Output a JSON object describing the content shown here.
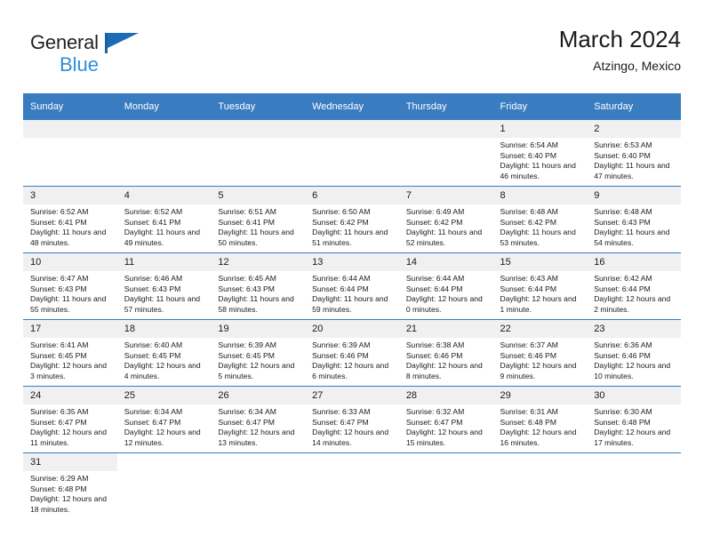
{
  "brand": {
    "name_part1": "General",
    "name_part2": "Blue",
    "flag_icon": "blue-flag-icon",
    "color_dark": "#231f20",
    "color_blue": "#2f8fd6"
  },
  "header": {
    "title": "March 2024",
    "subtitle": "Atzingo, Mexico"
  },
  "theme": {
    "header_blue": "#3a7cc0",
    "daynum_band": "#f0f0f0",
    "text": "#1a1a1a"
  },
  "columns": [
    "Sunday",
    "Monday",
    "Tuesday",
    "Wednesday",
    "Thursday",
    "Friday",
    "Saturday"
  ],
  "weeks": [
    [
      {
        "day": "",
        "empty": true
      },
      {
        "day": "",
        "empty": true
      },
      {
        "day": "",
        "empty": true
      },
      {
        "day": "",
        "empty": true
      },
      {
        "day": "",
        "empty": true
      },
      {
        "day": "1",
        "sunrise": "Sunrise: 6:54 AM",
        "sunset": "Sunset: 6:40 PM",
        "daylight": "Daylight: 11 hours and 46 minutes."
      },
      {
        "day": "2",
        "sunrise": "Sunrise: 6:53 AM",
        "sunset": "Sunset: 6:40 PM",
        "daylight": "Daylight: 11 hours and 47 minutes."
      }
    ],
    [
      {
        "day": "3",
        "sunrise": "Sunrise: 6:52 AM",
        "sunset": "Sunset: 6:41 PM",
        "daylight": "Daylight: 11 hours and 48 minutes."
      },
      {
        "day": "4",
        "sunrise": "Sunrise: 6:52 AM",
        "sunset": "Sunset: 6:41 PM",
        "daylight": "Daylight: 11 hours and 49 minutes."
      },
      {
        "day": "5",
        "sunrise": "Sunrise: 6:51 AM",
        "sunset": "Sunset: 6:41 PM",
        "daylight": "Daylight: 11 hours and 50 minutes."
      },
      {
        "day": "6",
        "sunrise": "Sunrise: 6:50 AM",
        "sunset": "Sunset: 6:42 PM",
        "daylight": "Daylight: 11 hours and 51 minutes."
      },
      {
        "day": "7",
        "sunrise": "Sunrise: 6:49 AM",
        "sunset": "Sunset: 6:42 PM",
        "daylight": "Daylight: 11 hours and 52 minutes."
      },
      {
        "day": "8",
        "sunrise": "Sunrise: 6:48 AM",
        "sunset": "Sunset: 6:42 PM",
        "daylight": "Daylight: 11 hours and 53 minutes."
      },
      {
        "day": "9",
        "sunrise": "Sunrise: 6:48 AM",
        "sunset": "Sunset: 6:43 PM",
        "daylight": "Daylight: 11 hours and 54 minutes."
      }
    ],
    [
      {
        "day": "10",
        "sunrise": "Sunrise: 6:47 AM",
        "sunset": "Sunset: 6:43 PM",
        "daylight": "Daylight: 11 hours and 55 minutes."
      },
      {
        "day": "11",
        "sunrise": "Sunrise: 6:46 AM",
        "sunset": "Sunset: 6:43 PM",
        "daylight": "Daylight: 11 hours and 57 minutes."
      },
      {
        "day": "12",
        "sunrise": "Sunrise: 6:45 AM",
        "sunset": "Sunset: 6:43 PM",
        "daylight": "Daylight: 11 hours and 58 minutes."
      },
      {
        "day": "13",
        "sunrise": "Sunrise: 6:44 AM",
        "sunset": "Sunset: 6:44 PM",
        "daylight": "Daylight: 11 hours and 59 minutes."
      },
      {
        "day": "14",
        "sunrise": "Sunrise: 6:44 AM",
        "sunset": "Sunset: 6:44 PM",
        "daylight": "Daylight: 12 hours and 0 minutes."
      },
      {
        "day": "15",
        "sunrise": "Sunrise: 6:43 AM",
        "sunset": "Sunset: 6:44 PM",
        "daylight": "Daylight: 12 hours and 1 minute."
      },
      {
        "day": "16",
        "sunrise": "Sunrise: 6:42 AM",
        "sunset": "Sunset: 6:44 PM",
        "daylight": "Daylight: 12 hours and 2 minutes."
      }
    ],
    [
      {
        "day": "17",
        "sunrise": "Sunrise: 6:41 AM",
        "sunset": "Sunset: 6:45 PM",
        "daylight": "Daylight: 12 hours and 3 minutes."
      },
      {
        "day": "18",
        "sunrise": "Sunrise: 6:40 AM",
        "sunset": "Sunset: 6:45 PM",
        "daylight": "Daylight: 12 hours and 4 minutes."
      },
      {
        "day": "19",
        "sunrise": "Sunrise: 6:39 AM",
        "sunset": "Sunset: 6:45 PM",
        "daylight": "Daylight: 12 hours and 5 minutes."
      },
      {
        "day": "20",
        "sunrise": "Sunrise: 6:39 AM",
        "sunset": "Sunset: 6:46 PM",
        "daylight": "Daylight: 12 hours and 6 minutes."
      },
      {
        "day": "21",
        "sunrise": "Sunrise: 6:38 AM",
        "sunset": "Sunset: 6:46 PM",
        "daylight": "Daylight: 12 hours and 8 minutes."
      },
      {
        "day": "22",
        "sunrise": "Sunrise: 6:37 AM",
        "sunset": "Sunset: 6:46 PM",
        "daylight": "Daylight: 12 hours and 9 minutes."
      },
      {
        "day": "23",
        "sunrise": "Sunrise: 6:36 AM",
        "sunset": "Sunset: 6:46 PM",
        "daylight": "Daylight: 12 hours and 10 minutes."
      }
    ],
    [
      {
        "day": "24",
        "sunrise": "Sunrise: 6:35 AM",
        "sunset": "Sunset: 6:47 PM",
        "daylight": "Daylight: 12 hours and 11 minutes."
      },
      {
        "day": "25",
        "sunrise": "Sunrise: 6:34 AM",
        "sunset": "Sunset: 6:47 PM",
        "daylight": "Daylight: 12 hours and 12 minutes."
      },
      {
        "day": "26",
        "sunrise": "Sunrise: 6:34 AM",
        "sunset": "Sunset: 6:47 PM",
        "daylight": "Daylight: 12 hours and 13 minutes."
      },
      {
        "day": "27",
        "sunrise": "Sunrise: 6:33 AM",
        "sunset": "Sunset: 6:47 PM",
        "daylight": "Daylight: 12 hours and 14 minutes."
      },
      {
        "day": "28",
        "sunrise": "Sunrise: 6:32 AM",
        "sunset": "Sunset: 6:47 PM",
        "daylight": "Daylight: 12 hours and 15 minutes."
      },
      {
        "day": "29",
        "sunrise": "Sunrise: 6:31 AM",
        "sunset": "Sunset: 6:48 PM",
        "daylight": "Daylight: 12 hours and 16 minutes."
      },
      {
        "day": "30",
        "sunrise": "Sunrise: 6:30 AM",
        "sunset": "Sunset: 6:48 PM",
        "daylight": "Daylight: 12 hours and 17 minutes."
      }
    ],
    [
      {
        "day": "31",
        "sunrise": "Sunrise: 6:29 AM",
        "sunset": "Sunset: 6:48 PM",
        "daylight": "Daylight: 12 hours and 18 minutes."
      },
      {
        "day": "",
        "empty": true,
        "trailing": true
      },
      {
        "day": "",
        "empty": true,
        "trailing": true
      },
      {
        "day": "",
        "empty": true,
        "trailing": true
      },
      {
        "day": "",
        "empty": true,
        "trailing": true
      },
      {
        "day": "",
        "empty": true,
        "trailing": true
      },
      {
        "day": "",
        "empty": true,
        "trailing": true
      }
    ]
  ]
}
